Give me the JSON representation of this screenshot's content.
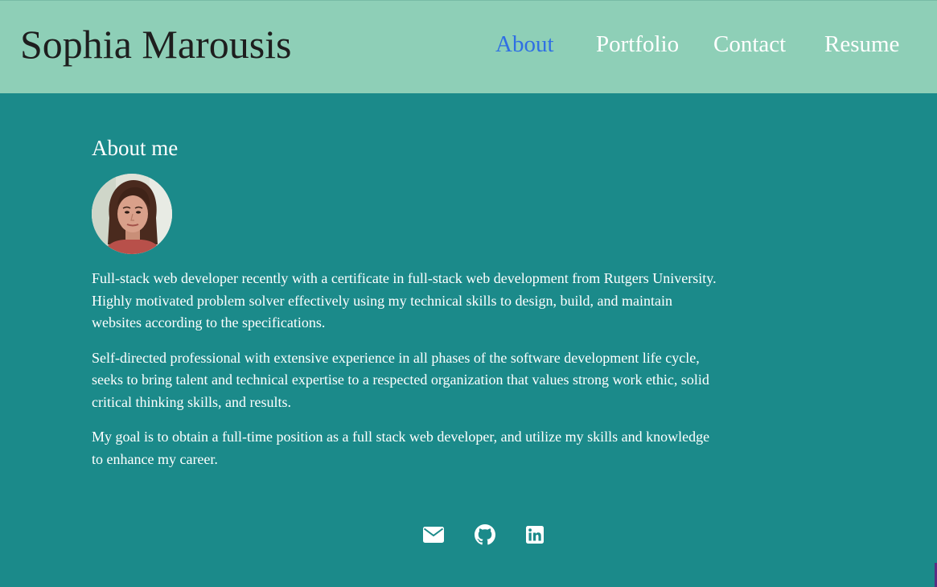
{
  "header": {
    "site_title": "Sophia Marousis",
    "nav": [
      {
        "label": "About",
        "active": true
      },
      {
        "label": "Portfolio",
        "active": false
      },
      {
        "label": "Contact",
        "active": false
      },
      {
        "label": "Resume",
        "active": false
      }
    ]
  },
  "about": {
    "heading": "About me",
    "paragraphs": [
      "Full-stack web developer recently with a certificate in full-stack web development from Rutgers University. Highly motivated problem solver effectively using my technical skills to design, build, and maintain websites according to the specifications.",
      "Self-directed professional with extensive experience in all phases of the software development life cycle, seeks to bring talent and technical expertise to a respected organization that values strong work ethic, solid critical thinking skills, and results.",
      "My goal is to obtain a full-time position as a full stack web developer, and utilize my skills and knowledge to enhance my career."
    ]
  },
  "footer": {
    "icons": [
      "envelope-icon",
      "github-icon",
      "linkedin-icon"
    ]
  },
  "colors": {
    "header_bg": "#8ecfb7",
    "page_bg": "#1b8a8a",
    "active_nav": "#2f6fe4",
    "text": "#ffffff"
  }
}
